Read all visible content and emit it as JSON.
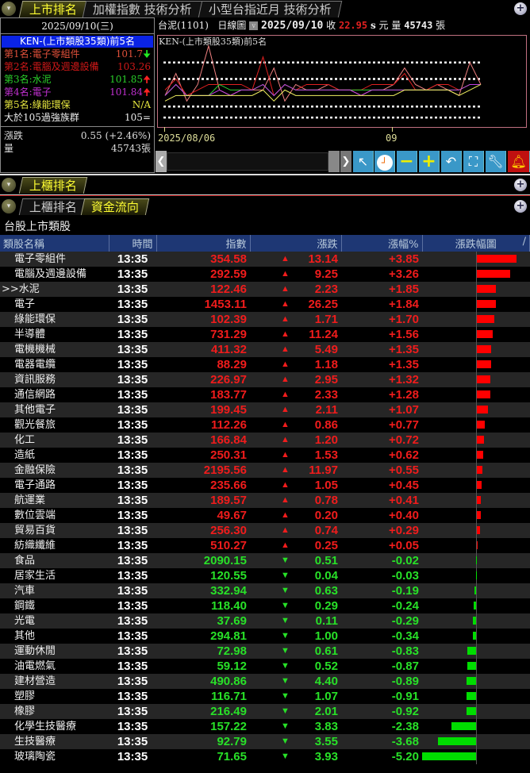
{
  "top_tabs": [
    "上市排名",
    "加權指數 技術分析",
    "小型台指近月 技術分析"
  ],
  "left_panel": {
    "date": "2025/09/10(三)",
    "ken_title": "KEN-(上市類股35類)前5名",
    "ranks": [
      {
        "label": "第1名:電子零組件",
        "value": "101.7",
        "arrow": "down",
        "color": "#e0503a"
      },
      {
        "label": "第2名:電腦及週邊設備",
        "value": "103.26",
        "arrow": "",
        "color": "#d01818"
      },
      {
        "label": "第3名:水泥",
        "value": "101.85",
        "arrow": "up",
        "color": "#2ad02a"
      },
      {
        "label": "第4名:電子",
        "value": "101.84",
        "arrow": "up",
        "color": "#c030d0"
      },
      {
        "label": "第5名:綠能環保",
        "value": "N/A",
        "arrow": "",
        "color": "#e8e840"
      },
      {
        "label": "大於105過強族群",
        "value": "105=",
        "arrow": "",
        "color": "#eeeeee"
      }
    ],
    "change_label": "漲跌",
    "change_value": "0.55 (+2.46%)",
    "volume_label": "量",
    "volume_value": "45743張"
  },
  "chart_panel": {
    "stock": "台泥(1101)",
    "period": "日線圖",
    "date": "2025/09/10",
    "close_label": "收",
    "close": "22.95",
    "s": "s",
    "unit": "元",
    "vol_label": "量",
    "volume": "45743",
    "vol_unit": "張",
    "chart_title": "KEN-(上市類股35類)前5名",
    "x_labels": [
      "2025/08/06",
      "09"
    ]
  },
  "chart_data": {
    "type": "line",
    "title": "KEN-(上市類股35類)前5名",
    "x_labels": [
      "2025/08/06",
      "09"
    ],
    "series": [
      {
        "name": "電子零組件",
        "color": "#f08080",
        "values": [
          99,
          103,
          98,
          101,
          108,
          100,
          99,
          100,
          100,
          100,
          104,
          98,
          101,
          100,
          100,
          101,
          100,
          100,
          99,
          100,
          100,
          101,
          104,
          101,
          100,
          101,
          100,
          99,
          105,
          101
        ]
      },
      {
        "name": "電腦及週邊設備",
        "color": "#e02020",
        "values": [
          100,
          102,
          99,
          100,
          101,
          101,
          101,
          101,
          100,
          106,
          99,
          101,
          100,
          101,
          101,
          101,
          100,
          100,
          100,
          101,
          101,
          101,
          103,
          100,
          100,
          101,
          101,
          100,
          101,
          101
        ]
      },
      {
        "name": "水泥",
        "color": "#30d030",
        "values": [
          99,
          101,
          99,
          99,
          99,
          101,
          100,
          100,
          100,
          101,
          99,
          101,
          100,
          100,
          100,
          100,
          100,
          100,
          100,
          100,
          100,
          100,
          100,
          100,
          100,
          100,
          100,
          100,
          101,
          101
        ]
      },
      {
        "name": "電子",
        "color": "#c040e0",
        "values": [
          99,
          101,
          99,
          99,
          99,
          100,
          99,
          100,
          100,
          101,
          99,
          101,
          100,
          100,
          100,
          100,
          100,
          100,
          99,
          100,
          100,
          100,
          100,
          100,
          100,
          100,
          100,
          100,
          101,
          101
        ]
      },
      {
        "name": "綠能環保",
        "color": "#f0f060",
        "values": [
          98,
          99,
          99,
          99,
          99,
          99,
          99,
          99,
          99,
          100,
          98,
          100,
          99,
          99,
          99,
          99,
          99,
          99,
          99,
          99,
          99,
          99,
          100,
          100,
          100,
          100,
          100,
          99,
          100,
          101
        ]
      }
    ],
    "reference_lines": [
      105,
      102,
      97,
      95
    ],
    "ylim": [
      93,
      110
    ]
  },
  "toolbar_icons": [
    "pointer-icon",
    "clock-icon",
    "zoom-out-icon",
    "zoom-in-icon",
    "undo-icon",
    "fit-icon",
    "settings-wrench-icon",
    "alert-bell-icon"
  ],
  "panel2": {
    "tabs": [
      "上櫃排名"
    ]
  },
  "panel3": {
    "tabs": [
      "上櫃排名",
      "資金流向"
    ],
    "subtitle": "台股上市類股"
  },
  "table": {
    "headers": [
      "類股名稱",
      "時間",
      "指數",
      "漲跌",
      "漲幅%",
      "漲跌幅圖"
    ],
    "rows": [
      [
        "電子零組件",
        "13:35",
        "354.58",
        "13.14",
        "+3.85"
      ],
      [
        "電腦及週邊設備",
        "13:35",
        "292.59",
        "9.25",
        "+3.26"
      ],
      [
        ">>水泥",
        "13:35",
        "122.46",
        "2.23",
        "+1.85"
      ],
      [
        "電子",
        "13:35",
        "1453.11",
        "26.25",
        "+1.84"
      ],
      [
        "綠能環保",
        "13:35",
        "102.39",
        "1.71",
        "+1.70"
      ],
      [
        "半導體",
        "13:35",
        "731.29",
        "11.24",
        "+1.56"
      ],
      [
        "電機機械",
        "13:35",
        "411.32",
        "5.49",
        "+1.35"
      ],
      [
        "電器電纜",
        "13:35",
        "88.29",
        "1.18",
        "+1.35"
      ],
      [
        "資訊服務",
        "13:35",
        "226.97",
        "2.95",
        "+1.32"
      ],
      [
        "通信網路",
        "13:35",
        "183.77",
        "2.33",
        "+1.28"
      ],
      [
        "其他電子",
        "13:35",
        "199.45",
        "2.11",
        "+1.07"
      ],
      [
        "觀光餐旅",
        "13:35",
        "112.26",
        "0.86",
        "+0.77"
      ],
      [
        "化工",
        "13:35",
        "166.84",
        "1.20",
        "+0.72"
      ],
      [
        "造紙",
        "13:35",
        "250.31",
        "1.53",
        "+0.62"
      ],
      [
        "金融保險",
        "13:35",
        "2195.56",
        "11.97",
        "+0.55"
      ],
      [
        "電子通路",
        "13:35",
        "235.66",
        "1.05",
        "+0.45"
      ],
      [
        "航運業",
        "13:35",
        "189.57",
        "0.78",
        "+0.41"
      ],
      [
        "數位雲端",
        "13:35",
        "49.67",
        "0.20",
        "+0.40"
      ],
      [
        "貿易百貨",
        "13:35",
        "256.30",
        "0.74",
        "+0.29"
      ],
      [
        "紡織纖維",
        "13:35",
        "510.27",
        "0.25",
        "+0.05"
      ],
      [
        "食品",
        "13:35",
        "2090.15",
        "0.51",
        "-0.02"
      ],
      [
        "居家生活",
        "13:35",
        "120.55",
        "0.04",
        "-0.03"
      ],
      [
        "汽車",
        "13:35",
        "332.94",
        "0.63",
        "-0.19"
      ],
      [
        "鋼鐵",
        "13:35",
        "118.40",
        "0.29",
        "-0.24"
      ],
      [
        "光電",
        "13:35",
        "37.69",
        "0.11",
        "-0.29"
      ],
      [
        "其他",
        "13:35",
        "294.81",
        "1.00",
        "-0.34"
      ],
      [
        "運動休閒",
        "13:35",
        "72.98",
        "0.61",
        "-0.83"
      ],
      [
        "油電燃氣",
        "13:35",
        "59.12",
        "0.52",
        "-0.87"
      ],
      [
        "建材營造",
        "13:35",
        "490.86",
        "4.40",
        "-0.89"
      ],
      [
        "塑膠",
        "13:35",
        "116.71",
        "1.07",
        "-0.91"
      ],
      [
        "橡膠",
        "13:35",
        "216.49",
        "2.01",
        "-0.92"
      ],
      [
        "化學生技醫療",
        "13:35",
        "157.22",
        "3.83",
        "-2.38"
      ],
      [
        "生技醫療",
        "13:35",
        "92.79",
        "3.55",
        "-3.68"
      ],
      [
        "玻璃陶瓷",
        "13:35",
        "71.65",
        "3.93",
        "-5.20"
      ]
    ]
  }
}
